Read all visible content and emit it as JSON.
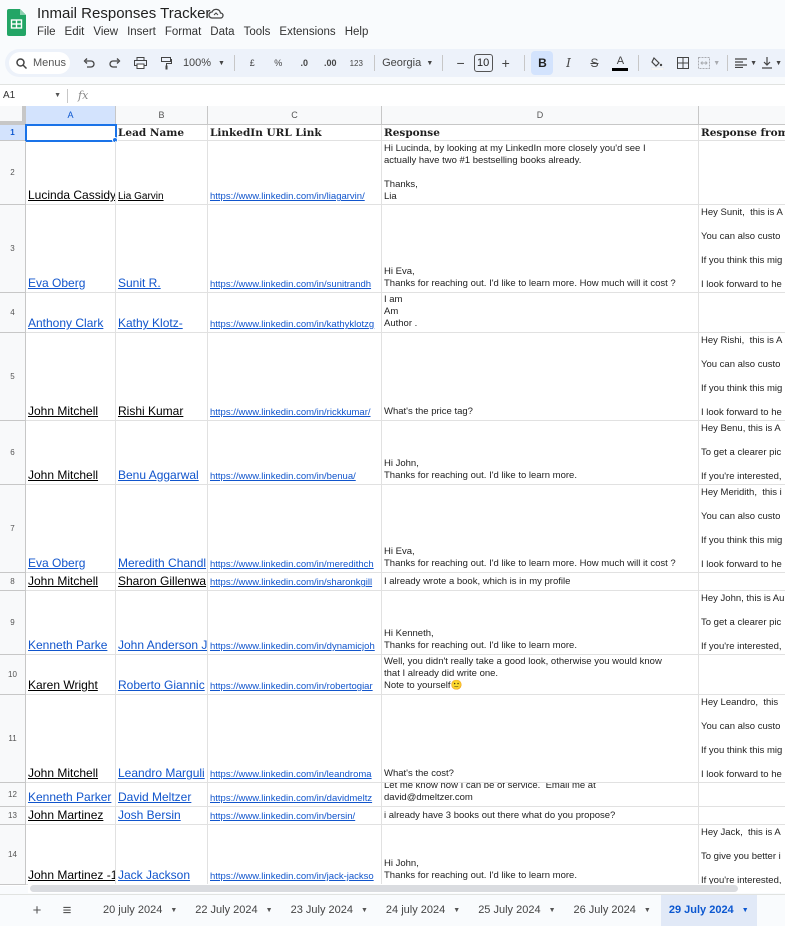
{
  "app": {
    "doc_title": "Inmail Responses Tracker",
    "menu": [
      "File",
      "Edit",
      "View",
      "Insert",
      "Format",
      "Data",
      "Tools",
      "Extensions",
      "Help"
    ]
  },
  "toolbar": {
    "search_label": "Menus",
    "zoom": "100%",
    "currency": "£",
    "percent": "%",
    "decrease_decimal": ".0",
    "increase_decimal": ".00",
    "number_format": "123",
    "font": "Georgia",
    "font_size": "10",
    "bold_active": true
  },
  "formula_bar": {
    "cell_ref": "A1",
    "fx_label": "fx",
    "value": ""
  },
  "sheet": {
    "columns": [
      "A",
      "B",
      "C",
      "D",
      ""
    ],
    "headers": [
      "",
      "Lead Name",
      "LinkedIn URL Link",
      "Response",
      "Response from W"
    ],
    "selected_cell": "A1",
    "rows": [
      {
        "num": "2",
        "a": "Lucinda Cassidy",
        "a_style": "dark",
        "b": "Lia Garvin",
        "b_style": "dark-small",
        "c": "https://www.linkedin.com/in/liagarvin/",
        "d": "Hi Lucinda, by looking at my LinkedIn more closely you'd see I\nactually have two #1 bestselling books already.\n\nThanks,\nLia",
        "d_align": "top",
        "e": ""
      },
      {
        "num": "3",
        "a": "Eva Oberg",
        "a_style": "link",
        "b": "Sunit R.",
        "b_style": "link",
        "c": "https://www.linkedin.com/in/sunitrandh",
        "d": "Hi Eva,\nThanks for reaching out. I'd like to learn more. How much will it cost ?",
        "d_align": "bottom",
        "e": "Hey Sunit,  this is A\n\nYou can also custo\n\nIf you think this mig\n\nI look forward to he"
      },
      {
        "num": "4",
        "a": "Anthony Clark",
        "a_style": "link",
        "b": "Kathy Klotz-",
        "b_style": "link",
        "c": "https://www.linkedin.com/in/kathyklotzg",
        "d": "I am\nAm\nAuthor .",
        "d_align": "bottom",
        "e": ""
      },
      {
        "num": "5",
        "a": "John Mitchell",
        "a_style": "dark",
        "b": "Rishi Kumar",
        "b_style": "dark",
        "c": "https://www.linkedin.com/in/rickkumar/",
        "d": "What's the price tag?",
        "d_align": "bottom",
        "e": "Hey Rishi,  this is A\n\nYou can also custo\n\nIf you think this mig\n\nI look forward to he"
      },
      {
        "num": "6",
        "a": "John Mitchell",
        "a_style": "dark",
        "b": "Benu Aggarwal",
        "b_style": "link",
        "c": "https://www.linkedin.com/in/benua/",
        "d": "Hi John,\nThanks for reaching out. I'd like to learn more.",
        "d_align": "bottom",
        "e": "Hey Benu, this is A\n\nTo get a clearer pic\n\nIf you're interested,"
      },
      {
        "num": "7",
        "a": "Eva Oberg",
        "a_style": "link",
        "b": "Meredith Chandl",
        "b_style": "link",
        "c": "https://www.linkedin.com/in/meredithch",
        "d": "Hi Eva,\nThanks for reaching out. I'd like to learn more. How much will it cost ?",
        "d_align": "bottom",
        "e": "Hey Meridith,  this i\n\nYou can also custo\n\nIf you think this mig\n\nI look forward to he"
      },
      {
        "num": "8",
        "a": "John Mitchell",
        "a_style": "dark",
        "b": "Sharon Gillenwa",
        "b_style": "dark",
        "c": "https://www.linkedin.com/in/sharonkgill",
        "d": "I already wrote a book, which is in my profile",
        "d_align": "bottom",
        "e": ""
      },
      {
        "num": "9",
        "a": "Kenneth Parke",
        "a_style": "link",
        "b": "John Anderson J",
        "b_style": "link",
        "c": "https://www.linkedin.com/in/dynamicjoh",
        "d": "Hi Kenneth,\nThanks for reaching out. I'd like to learn more.",
        "d_align": "bottom",
        "e": "Hey John, this is Au\n\nTo get a clearer pic\n\nIf you're interested,"
      },
      {
        "num": "10",
        "a": "Karen Wright",
        "a_style": "dark",
        "b": "Roberto Giannic",
        "b_style": "link",
        "c": "https://www.linkedin.com/in/robertogiar",
        "d": "Well, you didn't really take a good look, otherwise you would know\nthat I already did write one.\nNote to yourself🙂",
        "d_align": "bottom",
        "e": ""
      },
      {
        "num": "11",
        "a": "John Mitchell",
        "a_style": "dark",
        "b": "Leandro Marguli",
        "b_style": "link",
        "c": "https://www.linkedin.com/in/leandroma",
        "d": "What's the cost?",
        "d_align": "bottom",
        "e": "Hey Leandro,  this \n\nYou can also custo\n\nIf you think this mig\n\nI look forward to he"
      },
      {
        "num": "12",
        "a": "Kenneth Parker",
        "a_style": "link",
        "b": "David Meltzer",
        "b_style": "link",
        "c": "https://www.linkedin.com/in/davidmeltz",
        "d": "Let me know how I can be of service.  Email me at\ndavid@dmeltzer.com",
        "d_align": "bottom",
        "e": ""
      },
      {
        "num": "13",
        "a": "John Martinez",
        "a_style": "dark",
        "b": "Josh Bersin",
        "b_style": "link",
        "c": "https://www.linkedin.com/in/bersin/",
        "d": "i already have 3 books out there what do you propose?",
        "d_align": "bottom",
        "e": ""
      },
      {
        "num": "14",
        "a": "John Martinez -1",
        "a_style": "dark",
        "b": "Jack Jackson",
        "b_style": "link",
        "c": "https://www.linkedin.com/in/jack-jackso",
        "d": "Hi John,\nThanks for reaching out. I'd like to learn more.",
        "d_align": "bottom",
        "e": "Hey Jack,  this is A\n\nTo give you better i\n\nIf you're interested,"
      }
    ]
  },
  "sheet_tabs": [
    {
      "label": "20 july 2024",
      "active": false
    },
    {
      "label": "22 July 2024",
      "active": false
    },
    {
      "label": "23 July 2024",
      "active": false
    },
    {
      "label": "24 july 2024",
      "active": false
    },
    {
      "label": "25 July 2024",
      "active": false
    },
    {
      "label": "26 July 2024",
      "active": false
    },
    {
      "label": "29 July 2024",
      "active": true
    }
  ],
  "colors": {
    "accent": "#1a73e8",
    "link": "#1155cc",
    "sheets_green": "#23a566"
  }
}
